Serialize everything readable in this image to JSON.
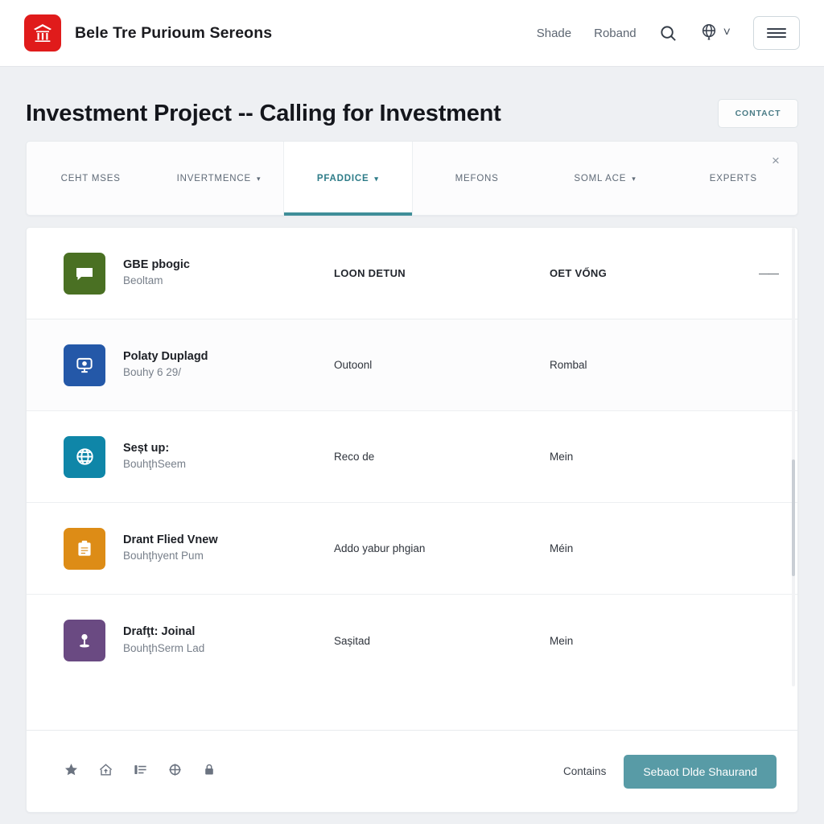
{
  "header": {
    "brand_name": "Bele Tre Purioum Sereons",
    "logo_icon": "temple-logo-icon",
    "nav": [
      {
        "label": "Shade"
      },
      {
        "label": "Roband"
      }
    ],
    "search_icon": "search-icon",
    "globe_icon": "globe-icon",
    "globe_caret": "˅",
    "menu_icon": "hamburger-menu-icon"
  },
  "page": {
    "title": "Investment Project -- Calling for Investment",
    "contact_label": "CONTACT"
  },
  "tabs": {
    "close_label": "×",
    "items": [
      {
        "label": "CEHT MSES",
        "has_caret": false,
        "active": false
      },
      {
        "label": "INVERTMENCE",
        "has_caret": true,
        "active": false
      },
      {
        "label": "PFADDICE",
        "has_caret": true,
        "active": true
      },
      {
        "label": "MEFONS",
        "has_caret": false,
        "active": false
      },
      {
        "label": "SOML ACE",
        "has_caret": true,
        "active": false
      },
      {
        "label": "EXPERTS",
        "has_caret": false,
        "active": false
      }
    ]
  },
  "list": {
    "header_row": {
      "icon": "dots-message-icon",
      "color": "#4a7023",
      "title": "GBE pbogic",
      "subtitle": "Beoltam",
      "col2": "LOON DETUN",
      "col3": "OET VỐNG",
      "trailing": "——"
    },
    "rows": [
      {
        "icon": "monitor-icon",
        "color": "#2458a8",
        "title": "Polaty Duplagd",
        "subtitle": "Bouhy 6 29/",
        "col2": "Outoonl",
        "col3": "Rombal"
      },
      {
        "icon": "globe-icon",
        "color": "#0f86a8",
        "title": "Seșt up:",
        "subtitle": "BouhţhSeem",
        "col2": "Reco de",
        "col3": "Mein"
      },
      {
        "icon": "clipboard-icon",
        "color": "#dd8c16",
        "title": "Drant Flied Vnew",
        "subtitle": "Bouhţhyent Pum",
        "col2": "Addo yabur phgian",
        "col3": "Méin"
      },
      {
        "icon": "user-pin-icon",
        "color": "#6a4a82",
        "title": "Drafţt: Joinal",
        "subtitle": "BouhţhSerm Lad",
        "col2": "Sașitad",
        "col3": "Mein"
      }
    ]
  },
  "footer": {
    "icons": [
      {
        "name": "star-icon"
      },
      {
        "name": "upload-home-icon"
      },
      {
        "name": "list-lines-icon"
      },
      {
        "name": "crosshair-globe-icon"
      },
      {
        "name": "lock-icon"
      }
    ],
    "note": "Contains",
    "primary_label": "Sebaot Dlde Shaurand"
  },
  "colors": {
    "accent_teal": "#3f8e99",
    "brand_red": "#e01b1b",
    "primary_button": "#589ba6",
    "page_bg": "#eef0f3"
  }
}
